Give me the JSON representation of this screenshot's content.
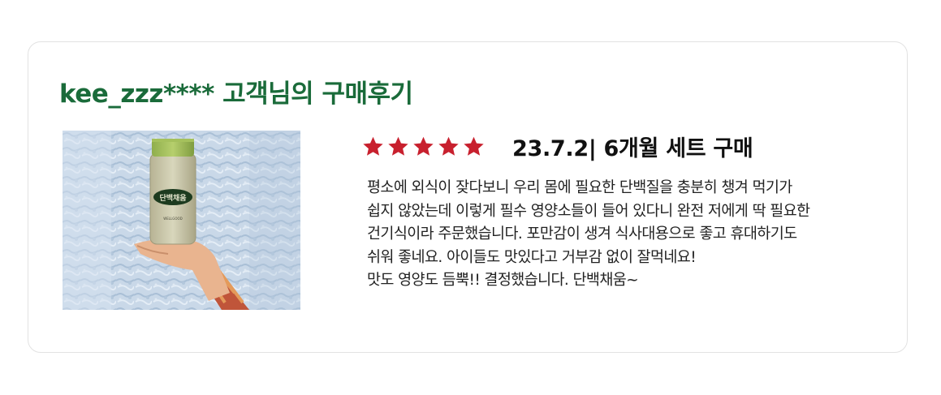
{
  "review": {
    "title": "kee_zzz**** 고객님의 구매후기",
    "rating": 5,
    "rating_max": 5,
    "star_color": "#c8202e",
    "title_color": "#1a6b3a",
    "purchase_info": "23.7.2| 6개월 세트 구매",
    "body_lines": [
      "평소에 외식이 잦다보니 우리 몸에 필요한 단백질을 충분히 챙겨 먹기가",
      "쉽지 않았는데 이렇게 필수 영양소들이 들어 있다니 완전 저에게 딱 필요한",
      "건기식이라 주문했습니다. 포만감이 생겨 식사대용으로 좋고 휴대하기도",
      "쉬워 좋네요. 아이들도 맛있다고 거부감 없이 잘먹네요!",
      "맛도 영양도 듬뿍!! 결정했습니다. 단백채움~"
    ],
    "photo": {
      "label": "단백채움",
      "brand": "WELLGOOD",
      "subject": "hand-holding-drink-bottle"
    }
  }
}
